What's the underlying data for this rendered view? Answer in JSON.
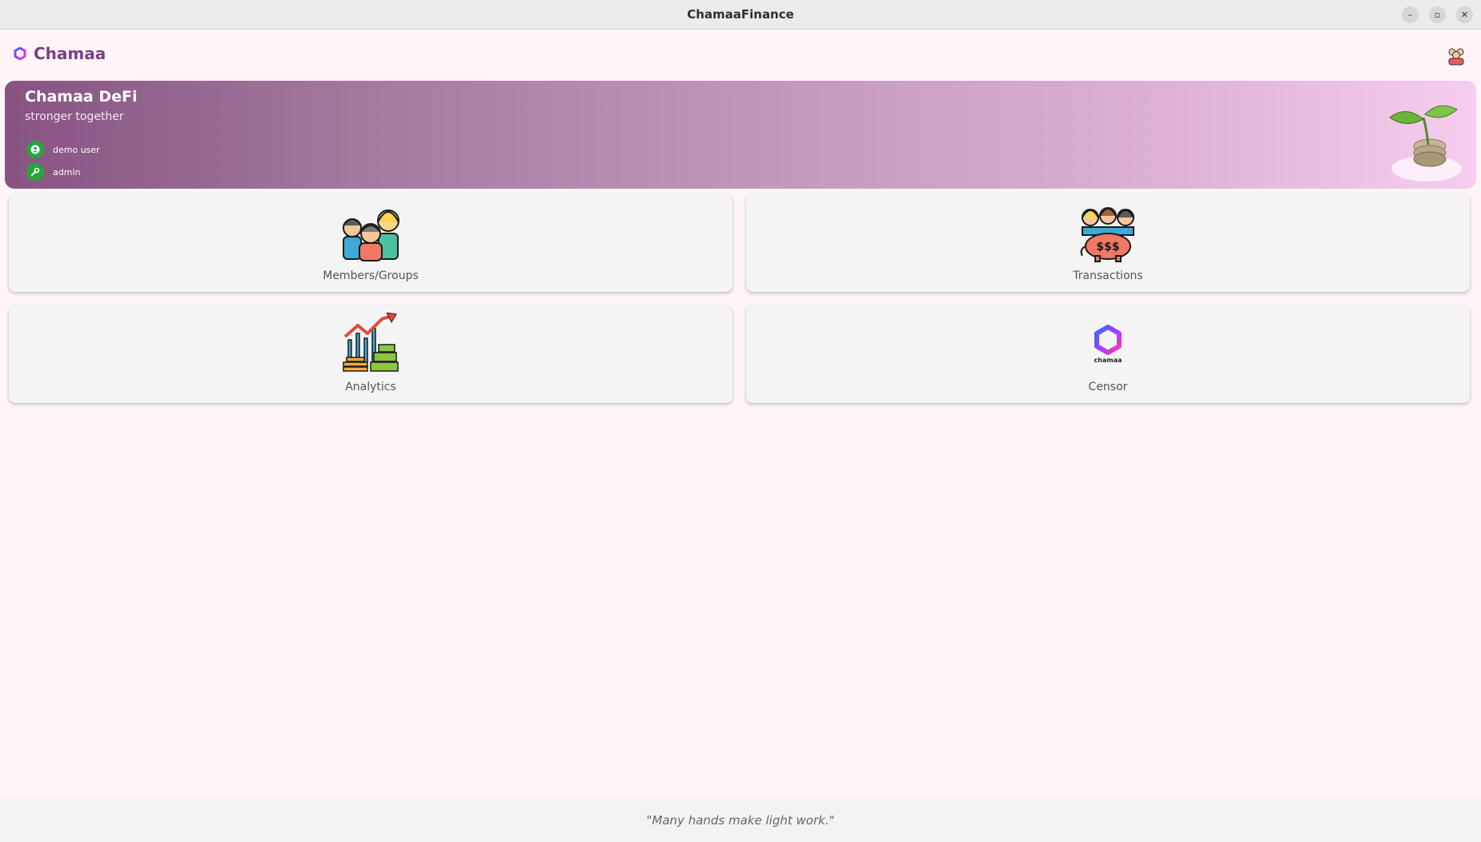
{
  "window": {
    "title": "ChamaaFinance",
    "controls": [
      {
        "name": "minimize-button",
        "glyph": "–"
      },
      {
        "name": "maximize-button",
        "glyph": "▫"
      },
      {
        "name": "close-button",
        "glyph": "✕"
      }
    ]
  },
  "appbar": {
    "brand": "Chamaa",
    "profile_icon": "profile-avatar-icon"
  },
  "hero": {
    "title": "Chamaa DeFi",
    "subtitle": "stronger together",
    "user_label": "demo user",
    "role_label": "admin",
    "user_icon": "account-circle-icon",
    "role_icon": "wrench-icon",
    "badge_color": "#24a63b",
    "gradient_start": "#885383",
    "gradient_end": "#f6cdef"
  },
  "cards": {
    "members": {
      "label": "Members/Groups",
      "icon": "group-people-icon"
    },
    "transactions": {
      "label": "Transactions",
      "icon": "piggy-bank-group-icon"
    },
    "analytics": {
      "label": "Analytics",
      "icon": "growth-chart-icon"
    },
    "censor": {
      "label": "Censor",
      "icon": "chamaa-logo-icon",
      "logo_text": "chamaa"
    }
  },
  "footer": {
    "quote": "\"Many hands make light work.\""
  },
  "colors": {
    "brand": "#7a3f84",
    "background": "#fff5f8",
    "card": "#f4f4f4"
  }
}
